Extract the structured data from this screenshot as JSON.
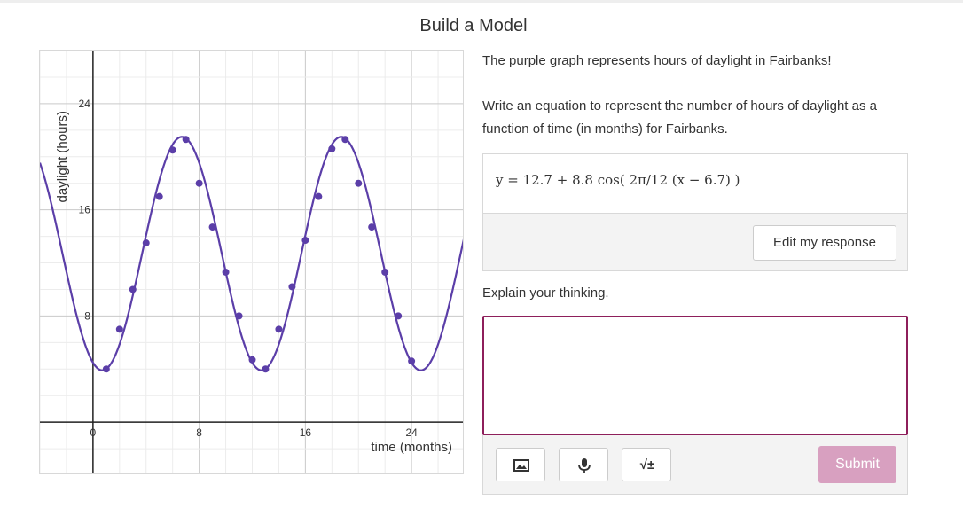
{
  "page": {
    "title": "Build a Model"
  },
  "prompt": {
    "line1": "The purple graph represents hours of daylight in Fairbanks!",
    "line2": "Write an equation to represent the number of hours of daylight as a function of time (in months) for Fairbanks."
  },
  "response": {
    "equation": "y = 12.7 + 8.8 cos( 2π/12 (x − 6.7) )",
    "edit_label": "Edit my response"
  },
  "explain": {
    "label": "Explain your thinking."
  },
  "toolbar": {
    "image_icon": "image-icon",
    "mic_icon": "microphone-icon",
    "math_label": "√±",
    "submit_label": "Submit"
  },
  "colors": {
    "accent": "#5b3ea8",
    "border_active": "#8e1f5b",
    "submit_disabled": "#d8a0c0"
  },
  "chart_data": {
    "type": "scatter",
    "title": "",
    "xlabel": "time (months)",
    "ylabel": "daylight (hours)",
    "xlim": [
      -4,
      28
    ],
    "ylim": [
      -4,
      28
    ],
    "x_ticks": [
      0,
      8,
      16,
      24
    ],
    "y_ticks": [
      8,
      16,
      24
    ],
    "grid": true,
    "curve": {
      "name": "",
      "a": 12.7,
      "b": 8.8,
      "period": 12,
      "shift": 6.7
    },
    "series": [
      {
        "name": "",
        "points": [
          [
            1,
            4
          ],
          [
            2,
            7
          ],
          [
            3,
            10
          ],
          [
            4,
            13.5
          ],
          [
            5,
            17
          ],
          [
            6,
            20.5
          ],
          [
            7,
            21.3
          ],
          [
            8,
            18
          ],
          [
            9,
            14.7
          ],
          [
            10,
            11.3
          ],
          [
            11,
            8
          ],
          [
            12,
            4.7
          ],
          [
            13,
            4
          ],
          [
            14,
            7
          ],
          [
            15,
            10.2
          ],
          [
            16,
            13.7
          ],
          [
            17,
            17
          ],
          [
            18,
            20.6
          ],
          [
            19,
            21.3
          ],
          [
            20,
            18
          ],
          [
            21,
            14.7
          ],
          [
            22,
            11.3
          ],
          [
            23,
            8
          ],
          [
            24,
            4.6
          ]
        ]
      }
    ]
  }
}
